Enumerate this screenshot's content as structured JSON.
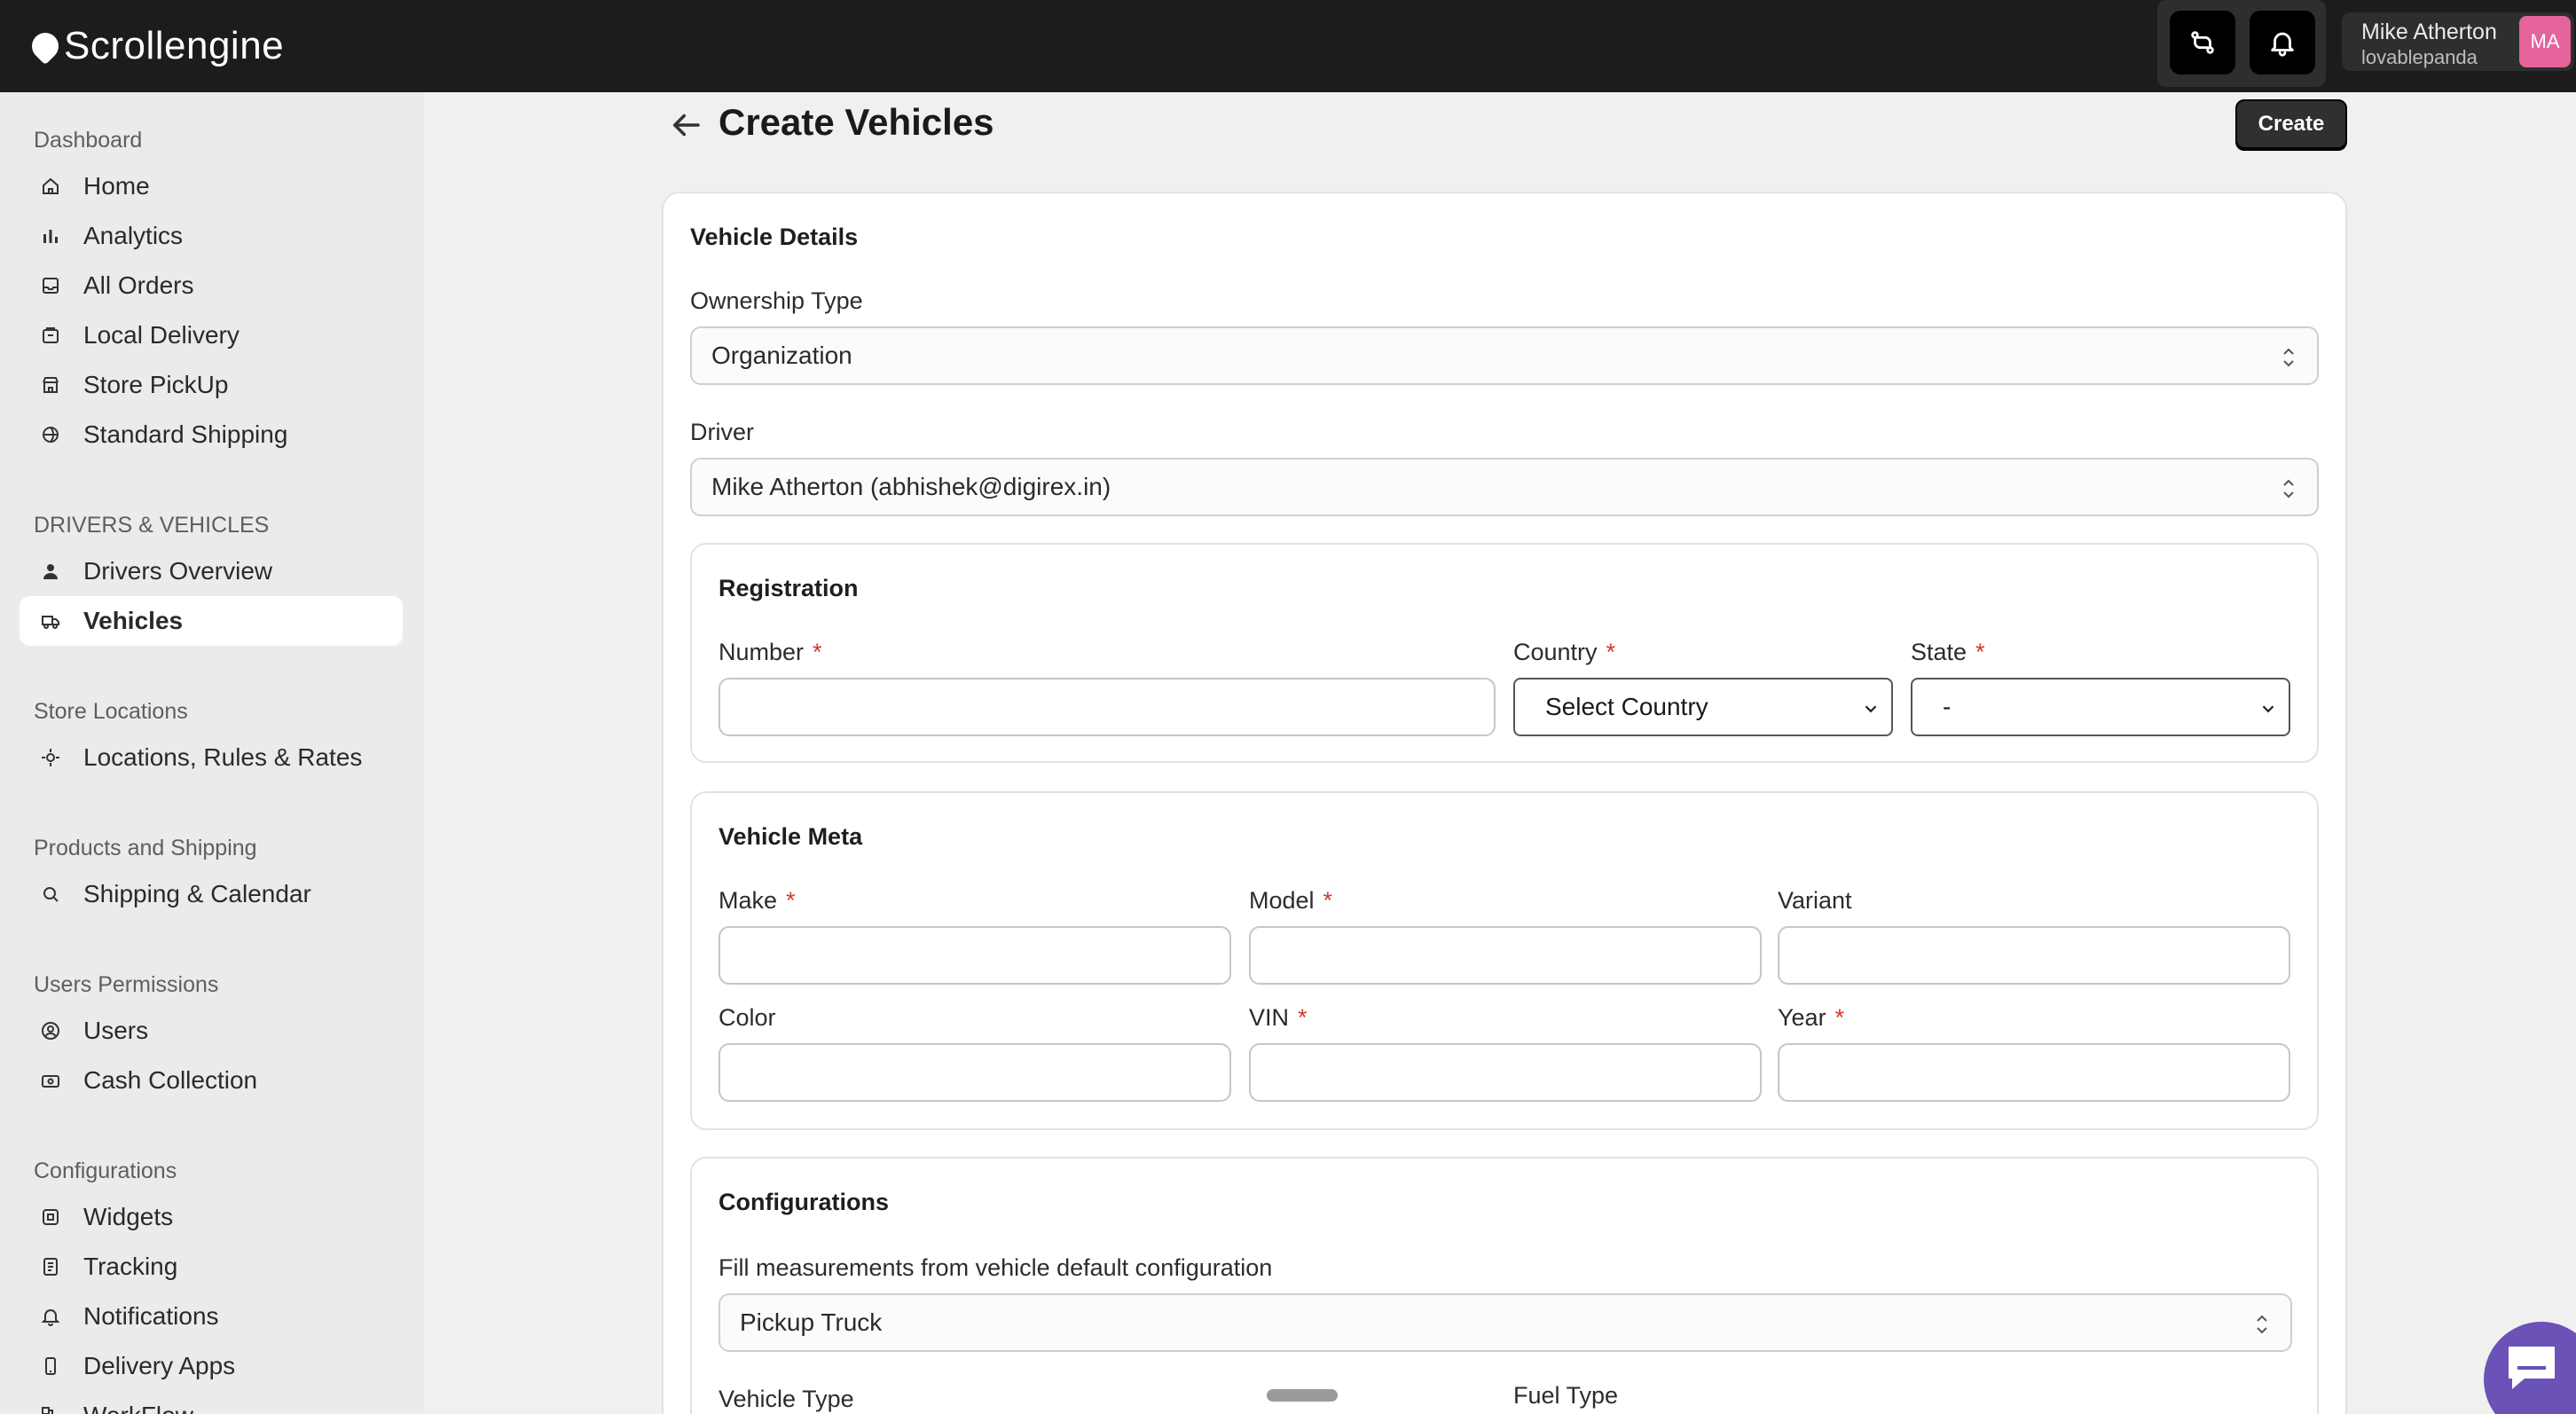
{
  "app": {
    "brand": "Scrollengine",
    "user": {
      "name": "Mike Atherton",
      "handle": "lovablepanda",
      "initials": "MA"
    },
    "accent_avatar": "#e5649b"
  },
  "sidebar": {
    "sections": [
      {
        "title": "Dashboard",
        "items": [
          {
            "label": "Home",
            "icon": "home-icon"
          },
          {
            "label": "Analytics",
            "icon": "bar-chart-icon"
          },
          {
            "label": "All Orders",
            "icon": "inbox-icon"
          },
          {
            "label": "Local Delivery",
            "icon": "box-icon"
          },
          {
            "label": "Store PickUp",
            "icon": "store-icon"
          },
          {
            "label": "Standard Shipping",
            "icon": "globe-icon"
          }
        ]
      },
      {
        "title": "DRIVERS & VEHICLES",
        "items": [
          {
            "label": "Drivers Overview",
            "icon": "user-icon"
          },
          {
            "label": "Vehicles",
            "icon": "truck-icon",
            "active": true
          }
        ]
      },
      {
        "title": "Store Locations",
        "items": [
          {
            "label": "Locations, Rules & Rates",
            "icon": "location-icon"
          }
        ]
      },
      {
        "title": "Products and Shipping",
        "items": [
          {
            "label": "Shipping & Calendar",
            "icon": "search-package-icon"
          }
        ]
      },
      {
        "title": "Users Permissions",
        "items": [
          {
            "label": "Users",
            "icon": "user-circle-icon"
          },
          {
            "label": "Cash Collection",
            "icon": "cash-icon"
          }
        ]
      },
      {
        "title": "Configurations",
        "items": [
          {
            "label": "Widgets",
            "icon": "widget-icon"
          },
          {
            "label": "Tracking",
            "icon": "list-icon"
          },
          {
            "label": "Notifications",
            "icon": "bell-icon"
          },
          {
            "label": "Delivery Apps",
            "icon": "phone-icon"
          },
          {
            "label": "WorkFlow",
            "icon": "workflow-icon"
          }
        ]
      }
    ]
  },
  "page": {
    "title": "Create Vehicles",
    "create_label": "Create"
  },
  "vehicle_details": {
    "heading": "Vehicle Details",
    "ownership_label": "Ownership Type",
    "ownership_value": "Organization",
    "driver_label": "Driver",
    "driver_value": "Mike Atherton (abhishek@digirex.in)"
  },
  "registration": {
    "heading": "Registration",
    "number_label": "Number",
    "number_value": "",
    "country_label": "Country",
    "country_value": "Select Country",
    "state_label": "State",
    "state_value": "-",
    "required_mark": "*"
  },
  "vehicle_meta": {
    "heading": "Vehicle Meta",
    "make_label": "Make",
    "model_label": "Model",
    "variant_label": "Variant",
    "color_label": "Color",
    "vin_label": "VIN",
    "year_label": "Year"
  },
  "configurations": {
    "heading": "Configurations",
    "fill_label": "Fill measurements from vehicle default configuration",
    "fill_value": "Pickup Truck",
    "vehicle_type_label": "Vehicle Type",
    "fuel_type_label": "Fuel Type"
  }
}
